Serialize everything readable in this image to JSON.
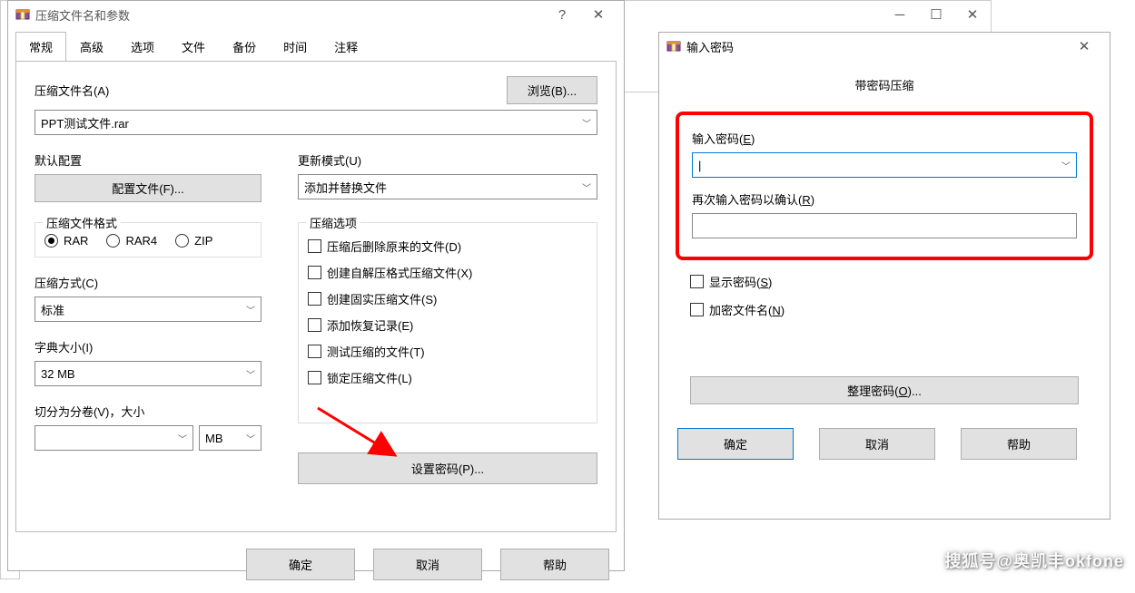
{
  "main_window": {
    "title": "压缩文件名和参数",
    "tabs": [
      "常规",
      "高级",
      "选项",
      "文件",
      "备份",
      "时间",
      "注释"
    ],
    "filename_label": "压缩文件名(A)",
    "browse_btn": "浏览(B)...",
    "filename_value": "PPT测试文件.rar",
    "default_profile_label": "默认配置",
    "profiles_btn": "配置文件(F)...",
    "update_mode_label": "更新模式(U)",
    "update_mode_value": "添加并替换文件",
    "format_label": "压缩文件格式",
    "format_rar": "RAR",
    "format_rar4": "RAR4",
    "format_zip": "ZIP",
    "method_label": "压缩方式(C)",
    "method_value": "标准",
    "dict_label": "字典大小(I)",
    "dict_value": "32 MB",
    "split_label": "切分为分卷(V)，大小",
    "split_value": "",
    "split_unit": "MB",
    "options_label": "压缩选项",
    "opt_delete": "压缩后删除原来的文件(D)",
    "opt_sfx": "创建自解压格式压缩文件(X)",
    "opt_solid": "创建固实压缩文件(S)",
    "opt_recovery": "添加恢复记录(E)",
    "opt_test": "测试压缩的文件(T)",
    "opt_lock": "锁定压缩文件(L)",
    "set_pwd_btn": "设置密码(P)...",
    "ok": "确定",
    "cancel": "取消",
    "help": "帮助"
  },
  "pwd_window": {
    "title": "输入密码",
    "header": "带密码压缩",
    "enter_label_pre": "输入密码(",
    "enter_label_key": "E",
    "enter_label_post": ")",
    "confirm_label_pre": "再次输入密码以确认(",
    "confirm_label_key": "R",
    "confirm_label_post": ")",
    "show_pwd_pre": "显示密码(",
    "show_pwd_key": "S",
    "show_pwd_post": ")",
    "encrypt_names_pre": "加密文件名(",
    "encrypt_names_key": "N",
    "encrypt_names_post": ")",
    "organize_pre": "整理密码(",
    "organize_key": "O",
    "organize_post": ")...",
    "ok": "确定",
    "cancel": "取消",
    "help": "帮助"
  },
  "watermark": "搜狐号@奥凯丰okfone"
}
